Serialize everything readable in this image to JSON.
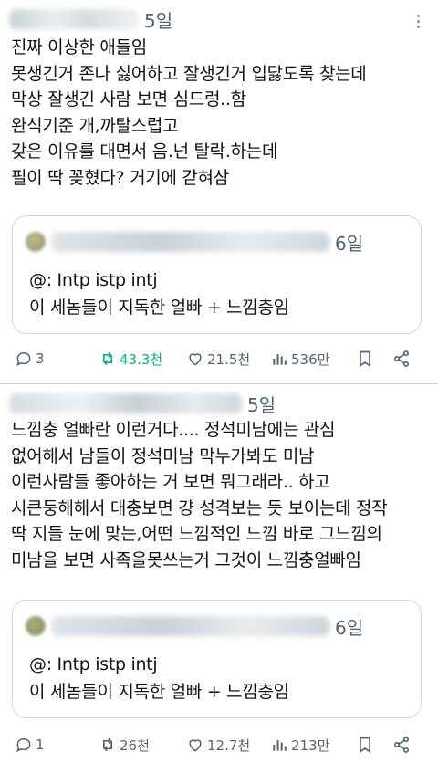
{
  "posts": [
    {
      "time": "5일",
      "text": "진짜 이상한 애들임\n못생긴거 존나 싫어하고 잘생긴거 입닳도록 찾는데\n막상 잘생긴 사람 보면 심드렁..함\n완식기준 개,까탈스럽고\n갖은 이유를 대면서 음.넌 탈락.하는데\n필이 딱 꽂혔다? 거기에 갇혀삼",
      "quote": {
        "time": "6일",
        "line1": "@: Intp istp intj",
        "line2": "이 세놈들이 지독한 얼빠 + 느낌충임"
      },
      "actions": {
        "replies": "3",
        "reposts": "43.3천",
        "likes": "21.5천",
        "views": "536만"
      }
    },
    {
      "time": "5일",
      "text": "느낌충 얼빠란 이런거다.... 정석미남에는 관심\n없어해서 남들이 정석미남 막누가봐도 미남\n이런사람들 좋아하는 거 보면 뭐그래라.. 하고\n시큰둥해해서 대충보면 걍 성격보는 듯 보이는데 정작\n딱 지들 눈에 맞는,어떤 느낌적인 느낌 바로 그느낌의\n미남을 보면 사족을못쓰는거 그것이 느낌충얼빠임",
      "quote": {
        "time": "6일",
        "line1": "@: Intp istp intj",
        "line2": "이 세놈들이 지독한 얼빠 + 느낌충임"
      },
      "actions": {
        "replies": "1",
        "reposts": "26천",
        "likes": "12.7천",
        "views": "213만"
      }
    }
  ],
  "icons": {
    "reply": "reply-icon",
    "repost": "repost-icon",
    "like": "heart-icon",
    "views": "views-icon",
    "bookmark": "bookmark-icon",
    "share": "share-icon",
    "more": "more-icon"
  },
  "colors": {
    "text": "#0f1419",
    "secondary": "#536471",
    "border": "#cfd9de",
    "repost_active": "#00ba7c"
  }
}
